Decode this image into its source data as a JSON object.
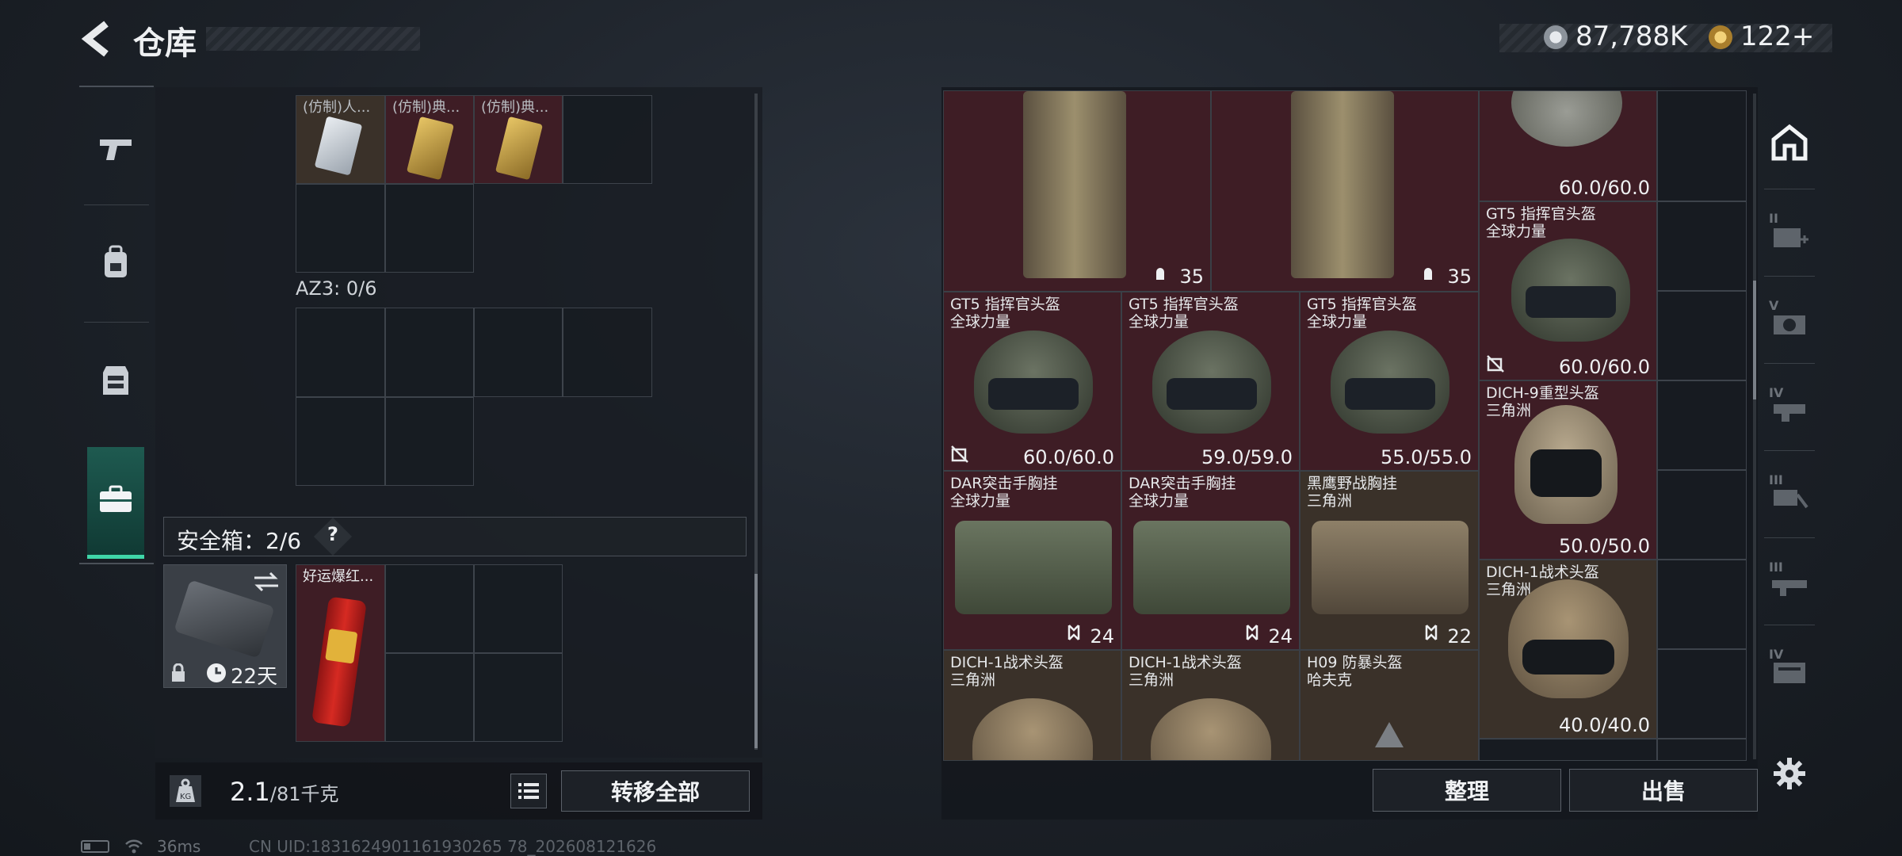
{
  "header": {
    "back_label": "<",
    "title": "仓库"
  },
  "currency": {
    "coins": "87,788K",
    "tokens": "122+"
  },
  "left_tabs": [
    "gun-icon",
    "backpack-icon",
    "vest-icon",
    "briefcase-icon"
  ],
  "left": {
    "top_items": [
      "(仿制)人...",
      "(仿制)典...",
      "(仿制)典..."
    ],
    "az3_label": "AZ3: 0/6",
    "safe_box": {
      "label": "安全箱：2/6",
      "help": "?",
      "time": "22天"
    },
    "lucky_item": "好运爆红...",
    "weight": {
      "current": "2.1",
      "max": "/81千克"
    },
    "transfer_all": "转移全部"
  },
  "stash": {
    "ammo_count": "35",
    "items": [
      {
        "name": "GT5 指挥官头盔",
        "sub": "全球力量",
        "dur": "60.0/60.0"
      },
      {
        "name": "GT5 指挥官头盔",
        "sub": "全球力量",
        "dur": "60.0/60.0"
      },
      {
        "name": "GT5 指挥官头盔",
        "sub": "全球力量",
        "dur": "59.0/59.0"
      },
      {
        "name": "GT5 指挥官头盔",
        "sub": "全球力量",
        "dur": "55.0/55.0"
      },
      {
        "name": "DICH-9重型头盔",
        "sub": "三角洲",
        "dur": "50.0/50.0"
      },
      {
        "name": "DAR突击手胸挂",
        "sub": "全球力量",
        "dur": "24"
      },
      {
        "name": "DAR突击手胸挂",
        "sub": "全球力量",
        "dur": "24"
      },
      {
        "name": "黑鹰野战胸挂",
        "sub": "三角洲",
        "dur": "22"
      },
      {
        "name": "DICH-1战术头盔",
        "sub": "三角洲",
        "dur": "40.0/40.0"
      },
      {
        "name": "DICH-1战术头盔",
        "sub": "三角洲",
        "dur": ""
      },
      {
        "name": "DICH-1战术头盔",
        "sub": "三角洲",
        "dur": ""
      },
      {
        "name": "H09 防暴头盔",
        "sub": "哈夫克",
        "dur": ""
      }
    ],
    "top_helmet_dur": "60.0/60.0",
    "sort_label": "整理",
    "sell_label": "出售"
  },
  "right_tabs": [
    "II",
    "V",
    "IV",
    "III",
    "III",
    "IV"
  ],
  "status": {
    "ping": "36ms",
    "uid": "CN UID:1831624901161930265 78_202608121626"
  }
}
